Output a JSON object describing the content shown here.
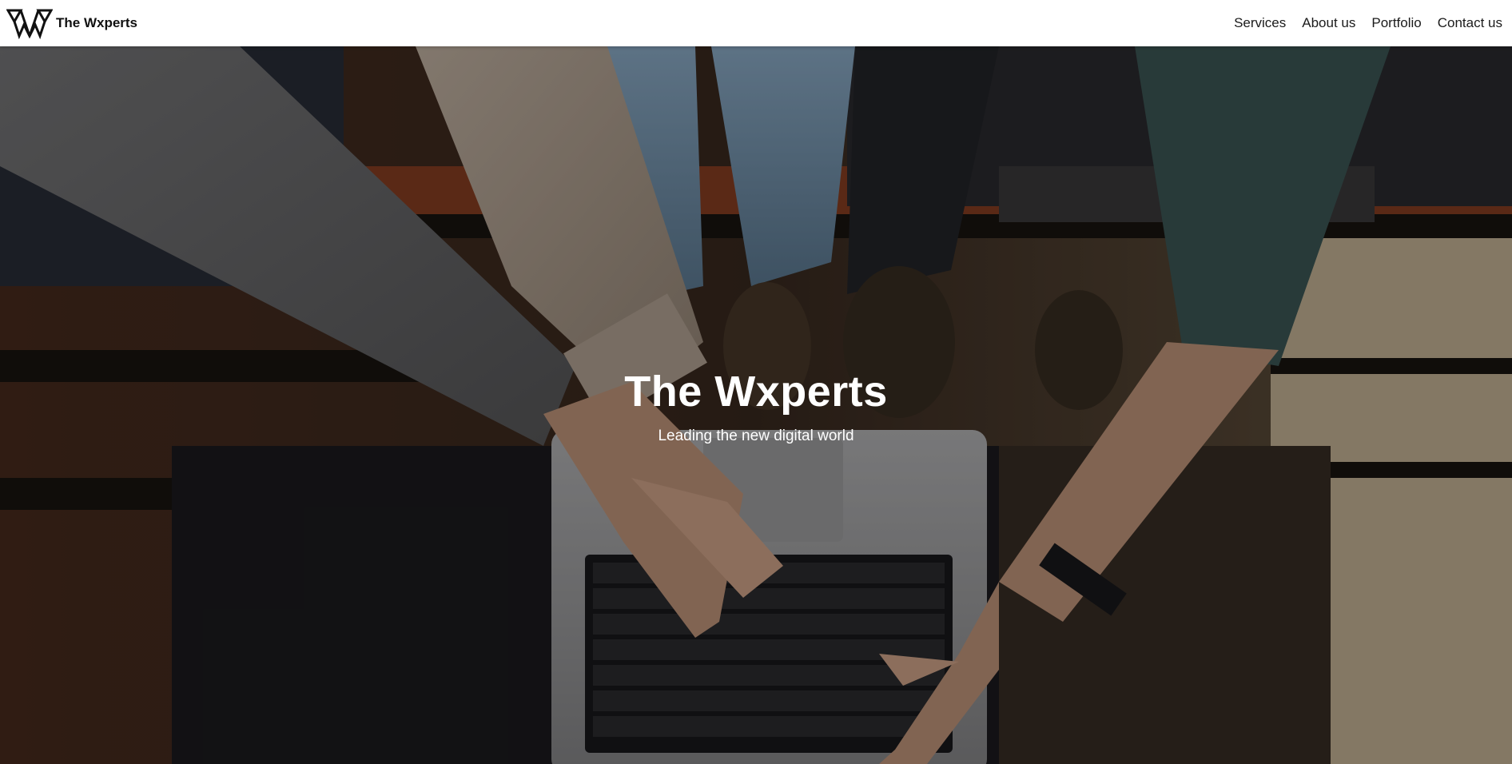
{
  "navbar": {
    "brand": {
      "name": "The Wxperts",
      "logo_icon": "wxperts-logo-icon"
    },
    "links": [
      {
        "label": "Services"
      },
      {
        "label": "About us"
      },
      {
        "label": "Portfolio"
      },
      {
        "label": "Contact us"
      }
    ]
  },
  "hero": {
    "title": "The Wxperts",
    "subtitle": "Leading the new digital world",
    "background": "team-hands-on-laptop-photo"
  },
  "colors": {
    "navbar_bg": "#ffffff",
    "nav_text": "#1b1b1b",
    "hero_text": "#ffffff",
    "hero_overlay": "#000000"
  }
}
